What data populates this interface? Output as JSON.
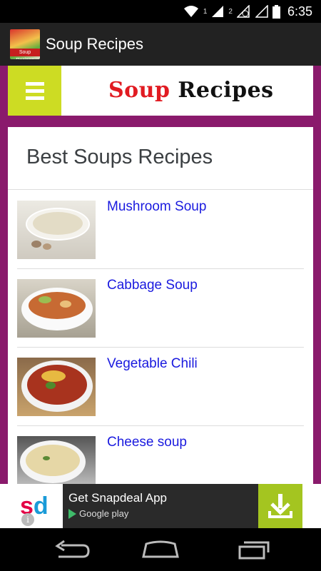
{
  "status_bar": {
    "time": "6:35",
    "sim1_label": "1",
    "sim2_label": "2",
    "icons": [
      "wifi-icon",
      "signal-icon",
      "signal-empty-icon",
      "battery-icon"
    ]
  },
  "action_bar": {
    "title": "Soup Recipes",
    "app_icon_band": "Soup Recipes",
    "bar_color": "#222222"
  },
  "banner": {
    "logo_word1": "Soup",
    "logo_word2": "Recipes",
    "menu_color": "#cddc23",
    "frame_color": "#8a1a6c"
  },
  "card": {
    "title": "Best Soups Recipes",
    "items": [
      {
        "name": "Mushroom Soup",
        "thumb": "mushroom-soup-image"
      },
      {
        "name": "Cabbage Soup",
        "thumb": "cabbage-soup-image"
      },
      {
        "name": "Vegetable Chili",
        "thumb": "vegetable-chili-image"
      },
      {
        "name": "Cheese soup",
        "thumb": "cheese-soup-image"
      }
    ],
    "link_color": "#1a1adf"
  },
  "ad": {
    "logo_s": "s",
    "logo_d": "d",
    "headline": "Get Snapdeal App",
    "store": "Google play",
    "info": "i",
    "download_color": "#a4c520"
  },
  "nav_bar": {
    "buttons": [
      "back-icon",
      "home-icon",
      "recent-apps-icon"
    ]
  }
}
